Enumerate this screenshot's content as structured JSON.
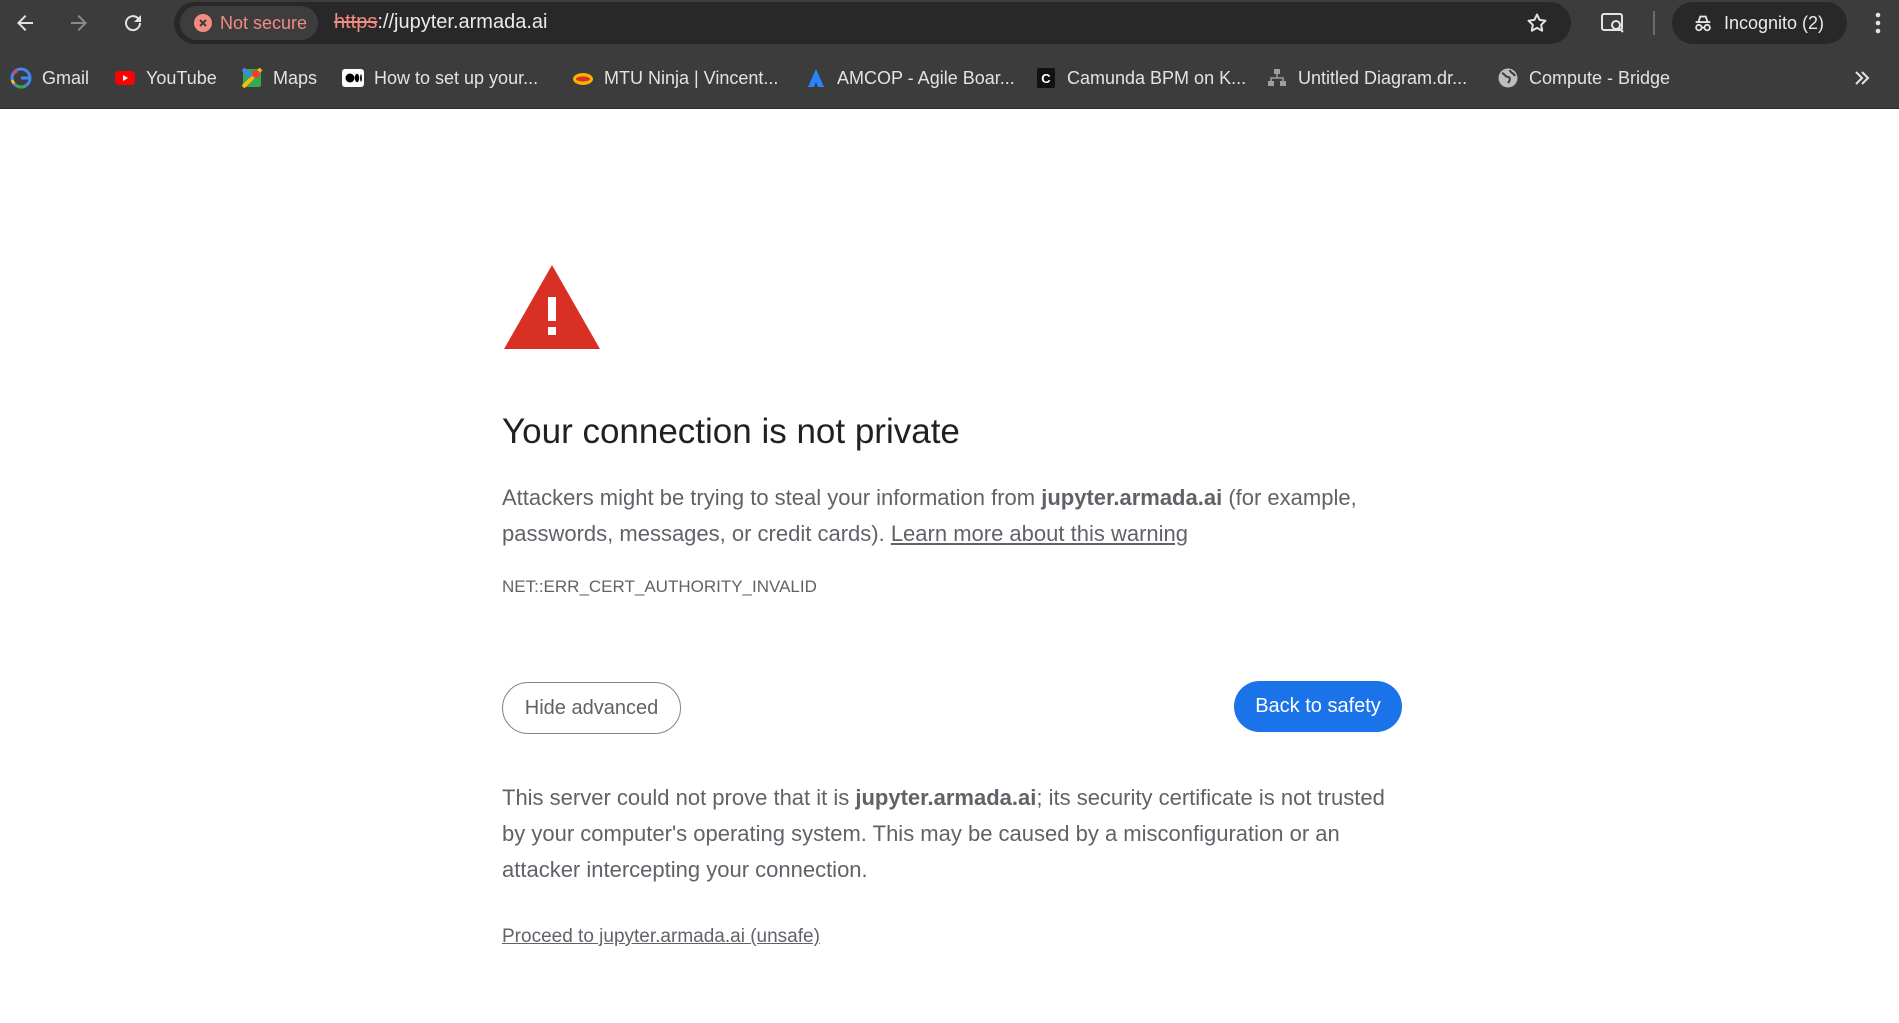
{
  "browser": {
    "security_label": "Not secure",
    "url_scheme": "https",
    "url_rest": "://jupyter.armada.ai",
    "incognito_label": "Incognito (2)",
    "accent_insecure": "#f28b82"
  },
  "bookmarks": [
    {
      "label": "Gmail",
      "icon": "google-icon"
    },
    {
      "label": "YouTube",
      "icon": "youtube-icon"
    },
    {
      "label": "Maps",
      "icon": "maps-icon"
    },
    {
      "label": "How to set up your...",
      "icon": "medium-icon"
    },
    {
      "label": "MTU Ninja | Vincent...",
      "icon": "ninja-icon"
    },
    {
      "label": "AMCOP - Agile Boar...",
      "icon": "atlassian-icon"
    },
    {
      "label": "Camunda BPM on K...",
      "icon": "camunda-icon"
    },
    {
      "label": "Untitled Diagram.dr...",
      "icon": "diagram-icon"
    },
    {
      "label": "Compute - Bridge",
      "icon": "globe-icon"
    }
  ],
  "page": {
    "heading": "Your connection is not private",
    "p1_before": "Attackers might be trying to steal your information from ",
    "p1_host": "jupyter.armada.ai",
    "p1_after": " (for example, passwords, messages, or credit cards). ",
    "p1_link": "Learn more about this warning",
    "error_code": "NET::ERR_CERT_AUTHORITY_INVALID",
    "hide_advanced": "Hide advanced",
    "back_to_safety": "Back to safety",
    "p2_before": "This server could not prove that it is ",
    "p2_host": "jupyter.armada.ai",
    "p2_after": "; its security certificate is not trusted by your computer's operating system. This may be caused by a misconfiguration or an attacker intercepting your connection.",
    "proceed_link": "Proceed to jupyter.armada.ai (unsafe)",
    "primary_color": "#1a73e8",
    "warning_color": "#d93025"
  }
}
